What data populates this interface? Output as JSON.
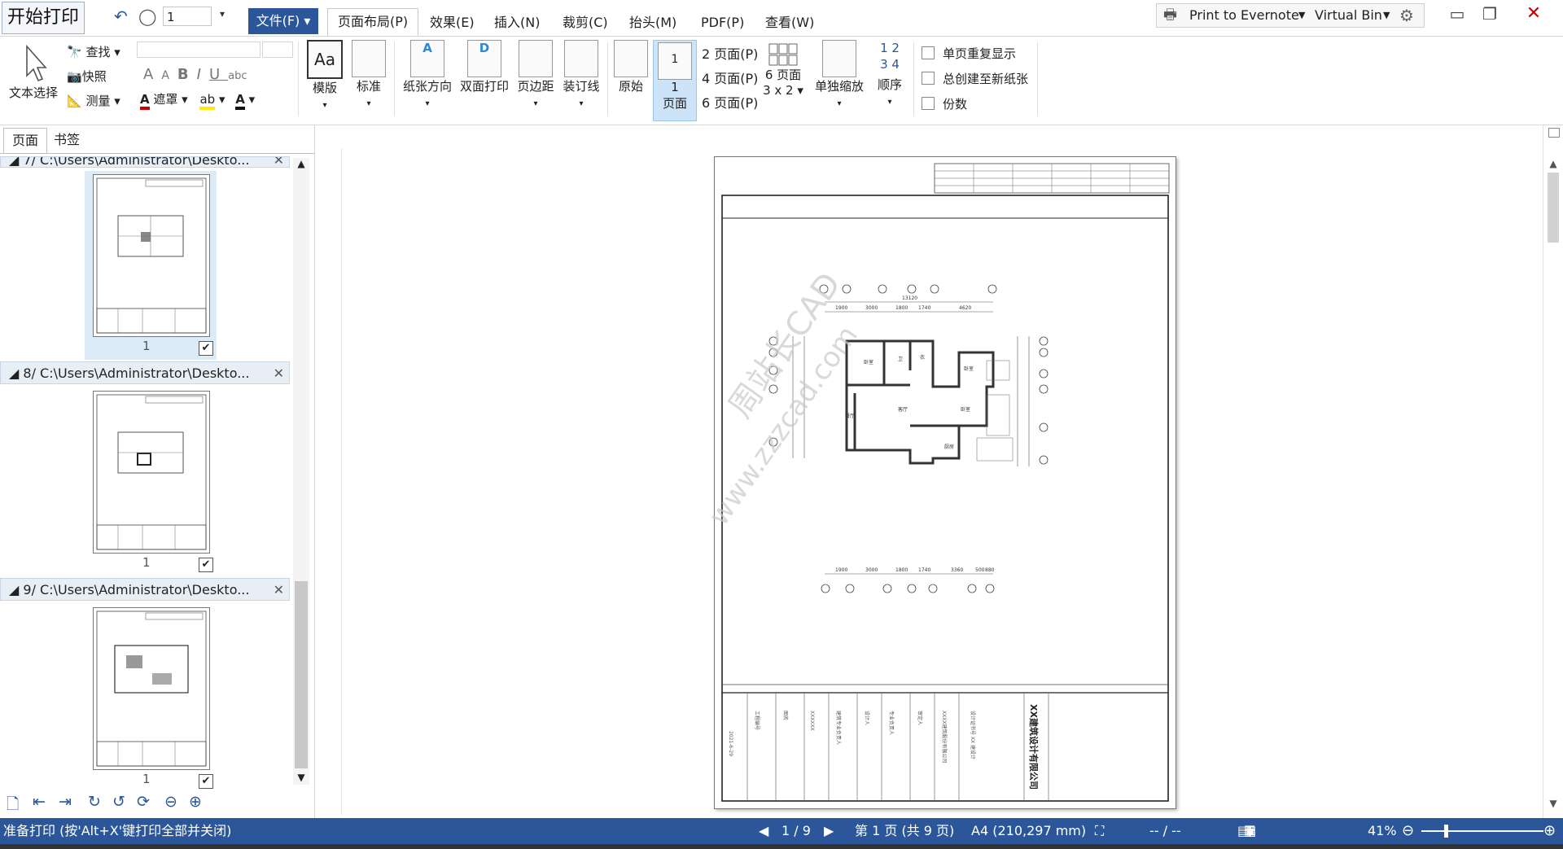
{
  "titlebar": {
    "start_print": "开始打印",
    "page_spin_value": "1",
    "file_menu": "文件(F)",
    "tabs": [
      "页面布局(P)",
      "效果(E)",
      "插入(N)",
      "裁剪(C)",
      "抬头(M)",
      "PDF(P)",
      "查看(W)"
    ],
    "printer": "Print to Evernote",
    "bin": "Virtual Bin"
  },
  "ribbon": {
    "text_select": "文本选择",
    "find": "查找",
    "snapshot": "快照",
    "measure": "测量",
    "mask": "遮罩",
    "template": "模版",
    "standard": "标准",
    "orientation": "纸张方向",
    "duplex": "双面打印",
    "margin": "页边距",
    "binding": "装订线",
    "original": "原始",
    "one_page_num": "1",
    "one_page": "页面",
    "two_pages": "2 页面(P)",
    "four_pages": "4 页面(P)",
    "six_pages": "6 页面(P)",
    "six_grid_a": "6 页面",
    "six_grid_b": "3 x 2",
    "single_scale": "单独缩放",
    "order": "顺序",
    "repeat_single": "单页重复显示",
    "always_new_sheet": "总创建至新纸张",
    "copies": "份数"
  },
  "leftpanel": {
    "tab_pages": "页面",
    "tab_bookmarks": "书签",
    "groups": [
      {
        "title": "7/ C:\\Users\\Administrator\\Deskto...",
        "num": "1"
      },
      {
        "title": "8/ C:\\Users\\Administrator\\Deskto...",
        "num": "1"
      },
      {
        "title": "9/ C:\\Users\\Administrator\\Deskto...",
        "num": "1"
      }
    ]
  },
  "document": {
    "watermark_1": "周站长CAD",
    "watermark_2": "www.zzzcad.com",
    "company": "XX建筑设计有限公司",
    "dims_top": [
      "1900",
      "3000",
      "1800",
      "1740",
      "4620"
    ],
    "dims_total": "13120",
    "dims_bottom": [
      "1900",
      "3000",
      "1800",
      "1740",
      "3360",
      "500",
      "880"
    ]
  },
  "statusbar": {
    "ready": "准备打印 (按'Alt+X'键打印全部并关闭)",
    "page_of": "1 / 9",
    "page_label": "第 1 页 (共 9 页)",
    "paper": "A4 (210,297 mm)",
    "coord": "-- / --",
    "zoom": "41%"
  }
}
